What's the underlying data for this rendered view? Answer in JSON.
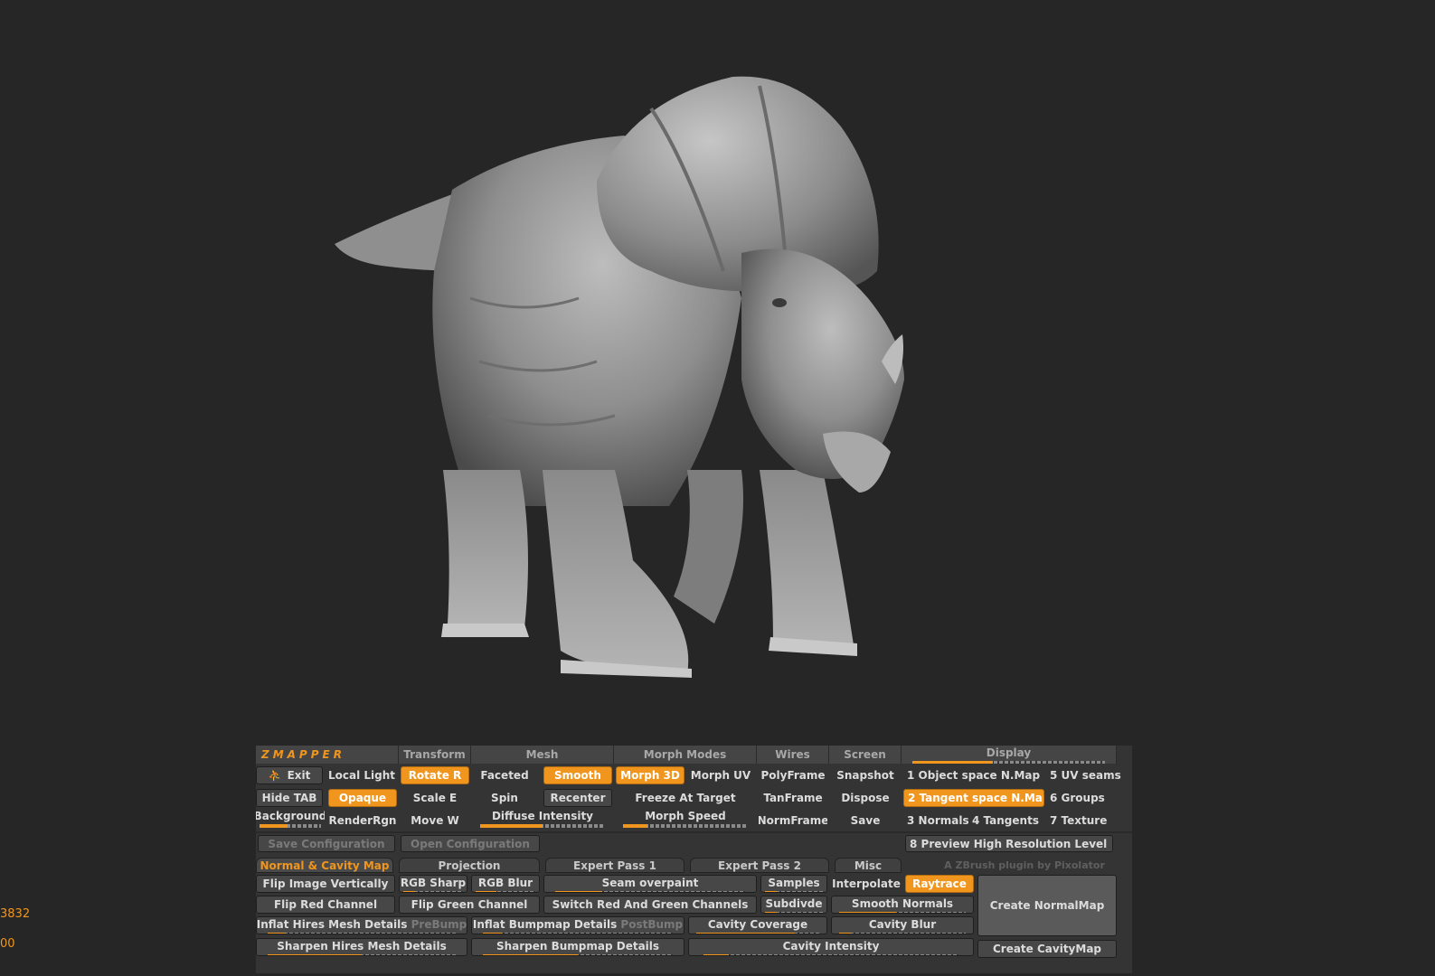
{
  "side_numbers": [
    "3832",
    "00"
  ],
  "plugin": {
    "title": "ZMAPPER",
    "credit": "A ZBrush plugin by Pixolator"
  },
  "headers": {
    "transform": "Transform",
    "mesh": "Mesh",
    "morph_modes": "Morph Modes",
    "wires": "Wires",
    "screen": "Screen",
    "display": "Display"
  },
  "buttons": {
    "exit": "Exit",
    "local_light": "Local Light",
    "rotate": "Rotate R",
    "faceted": "Faceted",
    "smooth": "Smooth",
    "morph_3d": "Morph 3D",
    "morph_uv": "Morph UV",
    "polyframe": "PolyFrame",
    "snapshot": "Snapshot",
    "hide_tab": "Hide TAB",
    "opaque": "Opaque",
    "scale": "Scale E",
    "spin": "Spin",
    "recenter": "Recenter",
    "freeze_at_target": "Freeze At Target",
    "tanframe": "TanFrame",
    "dispose": "Dispose",
    "background": "Background",
    "renderrgn": "RenderRgn",
    "move": "Move W",
    "diffuse_intensity": "Diffuse Intensity",
    "morph_speed": "Morph Speed",
    "normframe": "NormFrame",
    "save": "Save",
    "save_configuration": "Save Configuration",
    "open_configuration": "Open Configuration",
    "preview_high_res": "8 Preview High Resolution Level"
  },
  "display_list": [
    "1 Object space N.Map",
    "5 UV seams",
    "2 Tangent space N.Map",
    "6 Groups",
    "3 Normals",
    "4 Tangents",
    "7 Texture"
  ],
  "tabs": [
    "Normal & Cavity Map",
    "Projection",
    "Expert Pass 1",
    "Expert Pass 2",
    "Misc"
  ],
  "controls": {
    "flip_image_vertically": "Flip Image Vertically",
    "rgb_sharp": "RGB Sharp",
    "rgb_blur": "RGB Blur",
    "seam_overpaint": "Seam overpaint",
    "samples": "Samples",
    "interpolate": "Interpolate",
    "raytrace": "Raytrace",
    "create_normalmap": "Create NormalMap",
    "flip_red_channel": "Flip Red Channel",
    "flip_green_channel": "Flip Green Channel",
    "switch_red_green": "Switch Red And Green Channels",
    "subdivide": "Subdivde",
    "smooth_normals": "Smooth Normals",
    "inflat_hires": "Inflat Hires Mesh Details",
    "prebump": "PreBump",
    "inflat_bumpmap": "Inflat Bumpmap Details",
    "postbump": "PostBump",
    "cavity_coverage": "Cavity Coverage",
    "cavity_blur": "Cavity Blur",
    "sharpen_hires": "Sharpen Hires Mesh Details",
    "sharpen_bumpmap": "Sharpen Bumpmap Details",
    "cavity_intensity": "Cavity Intensity",
    "create_cavitymap": "Create CavityMap"
  },
  "sliders": {
    "display": 0.42,
    "background": 0.45,
    "diffuse_intensity": 0.5,
    "morph_speed": 0.2,
    "rgb_sharp": 0.2,
    "rgb_blur": 0.35,
    "seam_overpaint": 0.25,
    "samples": 0.2,
    "smooth_normals": 0.45,
    "inflat_hires": 0.1,
    "inflat_bumpmap": 0.1,
    "cavity_coverage": 0.8,
    "cavity_blur": 0.1,
    "sharpen_hires": 0.5,
    "sharpen_bumpmap": 0.5,
    "cavity_intensity": 0.1
  },
  "colors": {
    "accent": "#f0961e",
    "panel": "#343434",
    "canvas": "#262626"
  }
}
